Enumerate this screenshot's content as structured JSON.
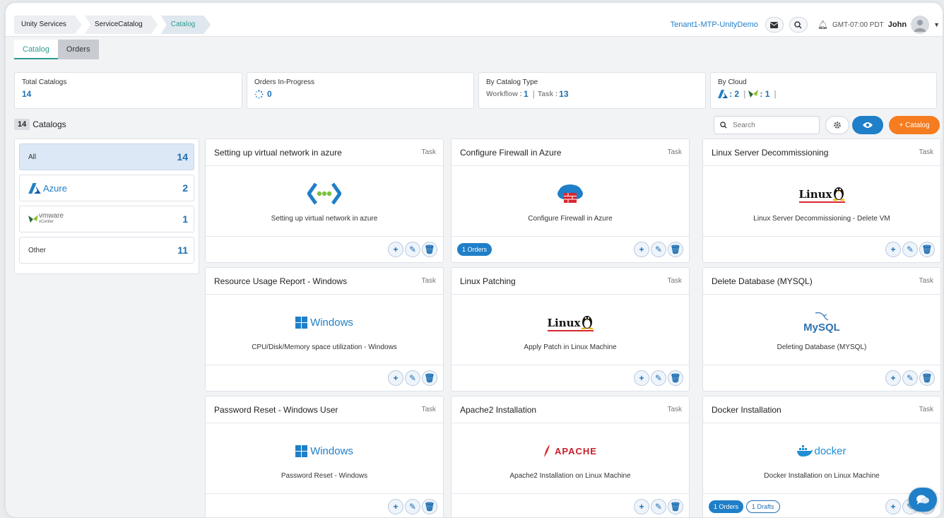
{
  "breadcrumb": [
    "Unity Services",
    "ServiceCatalog",
    "Catalog"
  ],
  "header": {
    "tenant": "Tenant1-MTP-UnityDemo",
    "timezone": "GMT-07:00 PDT",
    "user": "John"
  },
  "tabs": [
    "Catalog",
    "Orders"
  ],
  "stats": {
    "total_catalogs": {
      "label": "Total Catalogs",
      "value": "14"
    },
    "orders_in_progress": {
      "label": "Orders In-Progress",
      "value": "0"
    },
    "by_catalog_type": {
      "label": "By Catalog Type",
      "workflow_label": "Workflow :",
      "workflow_value": "1",
      "task_label": "Task :",
      "task_value": "13"
    },
    "by_cloud": {
      "label": "By Cloud",
      "azure_value": ": 2",
      "vmware_value": ": 1"
    }
  },
  "catalogs_header": {
    "count": "14",
    "label": "Catalogs"
  },
  "search": {
    "placeholder": "Search"
  },
  "add_catalog_label": "+ Catalog",
  "sidebar": [
    {
      "label": "All",
      "count": "14"
    },
    {
      "label": "Azure",
      "count": "2"
    },
    {
      "label": "vmware",
      "sublabel": "vCenter",
      "count": "1"
    },
    {
      "label": "Other",
      "count": "11"
    }
  ],
  "cards": [
    {
      "title": "Setting up virtual network in azure",
      "type": "Task",
      "logo": "azure-vnet-icon",
      "desc": "Setting up virtual network in azure"
    },
    {
      "title": "Configure Firewall in Azure",
      "type": "Task",
      "logo": "azure-firewall-icon",
      "desc": "Configure Firewall in Azure",
      "orders": "1 Orders"
    },
    {
      "title": "Linux Server Decommissioning",
      "type": "Task",
      "logo": "linux-logo",
      "logo_text": "Linux",
      "desc": "Linux Server Decommissioning - Delete VM"
    },
    {
      "title": "Resource Usage Report - Windows",
      "type": "Task",
      "logo": "windows-logo",
      "logo_text": "Windows",
      "desc": "CPU/Disk/Memory space utilization - Windows"
    },
    {
      "title": "Linux Patching",
      "type": "Task",
      "logo": "linux-logo",
      "logo_text": "Linux",
      "desc": "Apply Patch in Linux Machine"
    },
    {
      "title": "Delete Database (MYSQL)",
      "type": "Task",
      "logo": "mysql-logo",
      "logo_text": "MySQL",
      "desc": "Deleting Database (MYSQL)"
    },
    {
      "title": "Password Reset - Windows User",
      "type": "Task",
      "logo": "windows-logo",
      "logo_text": "Windows",
      "desc": "Password Reset - Windows"
    },
    {
      "title": "Apache2 Installation",
      "type": "Task",
      "logo": "apache-logo",
      "logo_text": "APACHE",
      "desc": "Apache2 Installation on Linux Machine"
    },
    {
      "title": "Docker Installation",
      "type": "Task",
      "logo": "docker-logo",
      "logo_text": "docker",
      "desc": "Docker Installation on Linux Machine",
      "orders": "1 Orders",
      "drafts": "1 Drafts"
    }
  ],
  "colors": {
    "accent": "#1f7fc8",
    "teal": "#2a9d8f",
    "orange": "#f57c1f"
  }
}
